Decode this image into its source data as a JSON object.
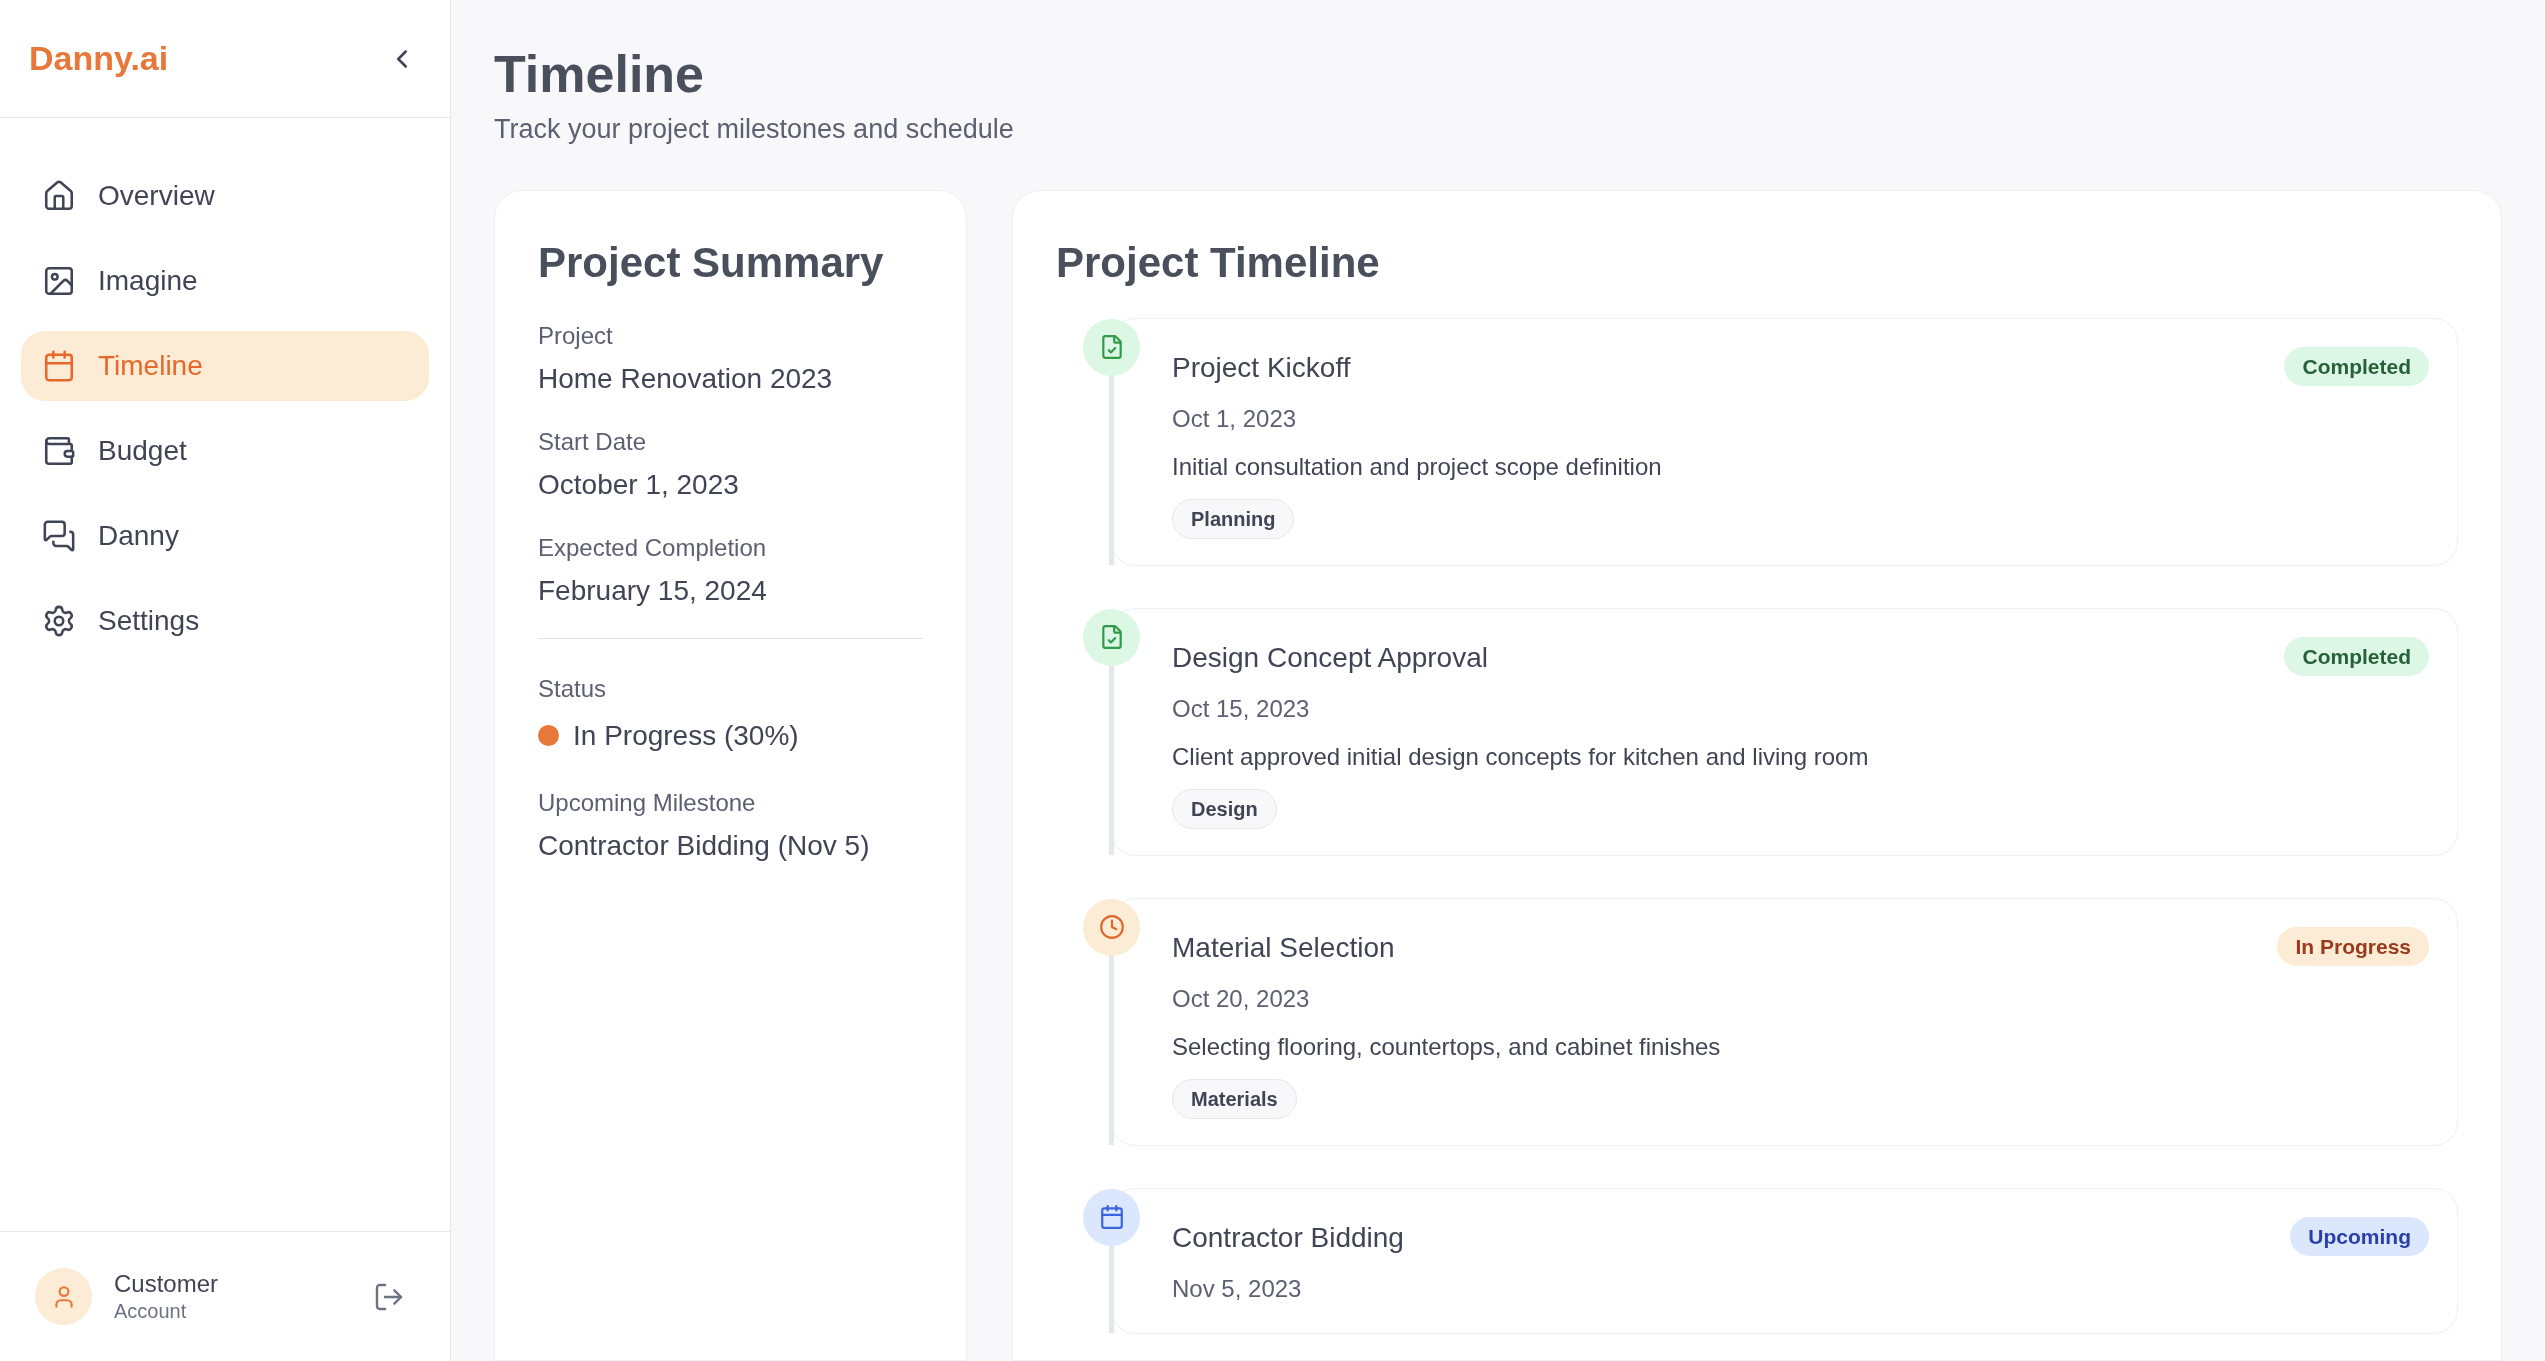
{
  "sidebar": {
    "logo": "Danny.ai",
    "items": [
      {
        "label": "Overview",
        "selected": false
      },
      {
        "label": "Imagine",
        "selected": false
      },
      {
        "label": "Timeline",
        "selected": true
      },
      {
        "label": "Budget",
        "selected": false
      },
      {
        "label": "Danny",
        "selected": false
      },
      {
        "label": "Settings",
        "selected": false
      }
    ],
    "user": {
      "name": "Customer",
      "role": "Account"
    }
  },
  "header": {
    "title": "Timeline",
    "subtitle": "Track your project milestones and schedule"
  },
  "summary": {
    "title": "Project Summary",
    "fields": [
      {
        "label": "Project",
        "value": "Home Renovation 2023"
      },
      {
        "label": "Start Date",
        "value": "October 1, 2023"
      },
      {
        "label": "Expected Completion",
        "value": "February 15, 2024"
      }
    ],
    "status": {
      "label": "Status",
      "value": "In Progress (30%)",
      "color": "#e8773a"
    },
    "milestone": {
      "label": "Upcoming Milestone",
      "value": "Contractor Bidding (Nov 5)"
    }
  },
  "timeline": {
    "title": "Project Timeline",
    "items": [
      {
        "kind": "completed",
        "title": "Project Kickoff",
        "date": "Oct 1, 2023",
        "description": "Initial consultation and project scope definition",
        "tag": "Planning",
        "badge": "Completed"
      },
      {
        "kind": "completed",
        "title": "Design Concept Approval",
        "date": "Oct 15, 2023",
        "description": "Client approved initial design concepts for kitchen and living room",
        "tag": "Design",
        "badge": "Completed"
      },
      {
        "kind": "in_progress",
        "title": "Material Selection",
        "date": "Oct 20, 2023",
        "description": "Selecting flooring, countertops, and cabinet finishes",
        "tag": "Materials",
        "badge": "In Progress"
      },
      {
        "kind": "upcoming",
        "title": "Contractor Bidding",
        "date": "Nov 5, 2023",
        "badge": "Upcoming"
      }
    ]
  }
}
